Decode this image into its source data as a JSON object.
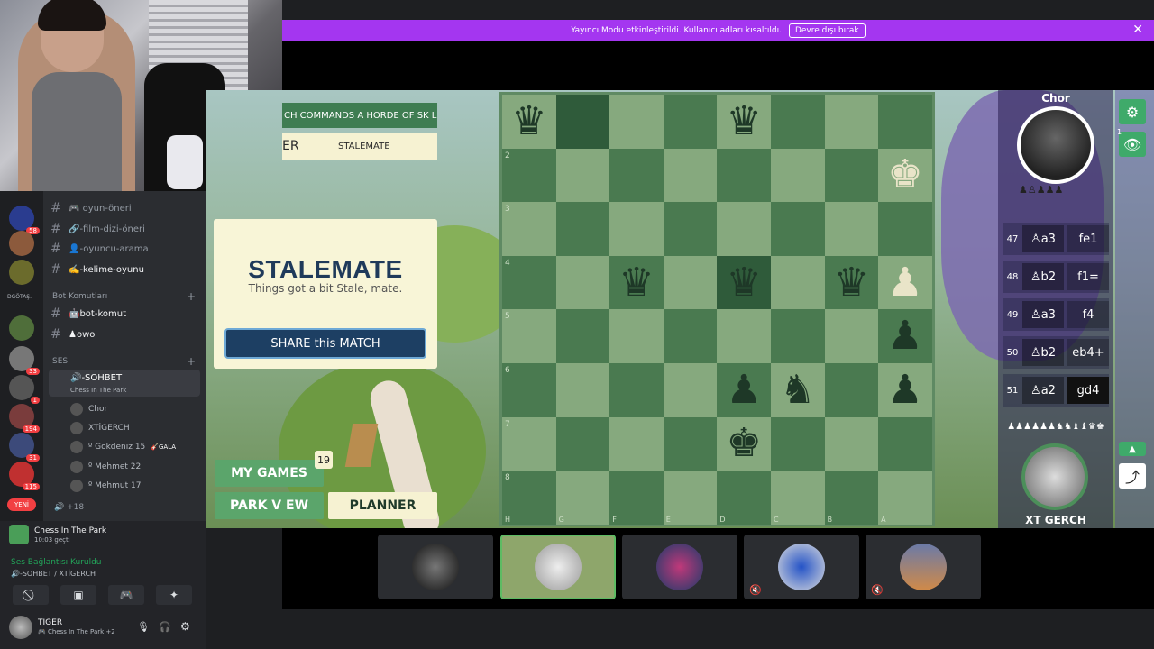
{
  "notice": {
    "text": "Yayıncı Modu etkinleştirildi. Kullanıcı adları kısaltıldı.",
    "button": "Devre dışı bırak",
    "close": "✕"
  },
  "game": {
    "headline": "CH COMMANDS A HORDE OF SK LLS",
    "result_left": "ER",
    "result_right": "STALEMATE",
    "card_title": "STALEMATE",
    "card_sub": "Things got a bit Stale, mate.",
    "share_button": "SHARE this MATCH",
    "my_games": "MY GAMES",
    "my_games_count": "19",
    "park_view": "PARK V EW",
    "planner": "PLANNER",
    "ranks": [
      "",
      "2",
      "3",
      "4",
      "5",
      "6",
      "7",
      "8"
    ],
    "files": [
      "H",
      "G",
      "F",
      "E",
      "D",
      "C",
      "B",
      "A"
    ]
  },
  "opponent": {
    "name": "Chor",
    "captured": "♟♙♟♟♟"
  },
  "me": {
    "name": "XT GERCH",
    "captured": "♟♟♟♟♟♟♞♞♝♝♛♚"
  },
  "moves": [
    {
      "n": "47",
      "w": "♙a3",
      "b": "fe1",
      "cur": false
    },
    {
      "n": "48",
      "w": "♙b2",
      "b": "f1=",
      "cur": false
    },
    {
      "n": "49",
      "w": "♙a3",
      "b": "f4",
      "cur": false
    },
    {
      "n": "50",
      "w": "♙b2",
      "b": "eb4+",
      "cur": false
    },
    {
      "n": "51",
      "w": "♙a2",
      "b": "gd4",
      "cur": true
    }
  ],
  "strip": {
    "gear": "⚙",
    "eye": "👁",
    "count": "1",
    "up": "▲",
    "share": "⤴"
  },
  "sidebar": {
    "channels": [
      {
        "name": "🎮 oyun-öneri",
        "bright": false
      },
      {
        "name": "🔗-film-dizi-öneri",
        "bright": false
      },
      {
        "name": "👤-oyuncu-arama",
        "bright": false
      },
      {
        "name": "✍️-kelime-oyunu",
        "bright": true
      }
    ],
    "bot_category": "Bot Komutları",
    "bot_channels": [
      {
        "name": "🤖bot-komut"
      },
      {
        "name": "♟owo"
      }
    ],
    "voice_category": "SES",
    "voice_channel": "🔊-SOHBET",
    "voice_activity": "Chess In The Park",
    "voice_users": [
      {
        "name": "Chor",
        "tag": ""
      },
      {
        "name": "XTİGERCH",
        "tag": ""
      },
      {
        "name": "º Gökdeniz 15",
        "tag": "🎸GALA"
      },
      {
        "name": "º Mehmet 22",
        "tag": ""
      },
      {
        "name": "º Mehmut 17",
        "tag": ""
      }
    ],
    "more_users": "+18",
    "guild_label": "DGÖTAŞ.",
    "guild_badges": [
      "58",
      "33",
      "1",
      "194",
      "31",
      "115"
    ],
    "new_label": "YENİ"
  },
  "voice_panel": {
    "activity_title": "Chess In The Park",
    "activity_time": "10:03 geçti",
    "connection": "Ses Bağlantısı Kuruldu",
    "channel": "🔊-SOHBET / XTİGERCH",
    "user_name": "TIGER",
    "user_status": "🎮 Chess In The Park +2"
  },
  "colors": {
    "accent_purple": "#a436f0",
    "board_light": "#86a97e",
    "board_dark": "#4a7a50",
    "panel_cream": "#f8f5d7",
    "share_blue": "#1d3f63"
  }
}
